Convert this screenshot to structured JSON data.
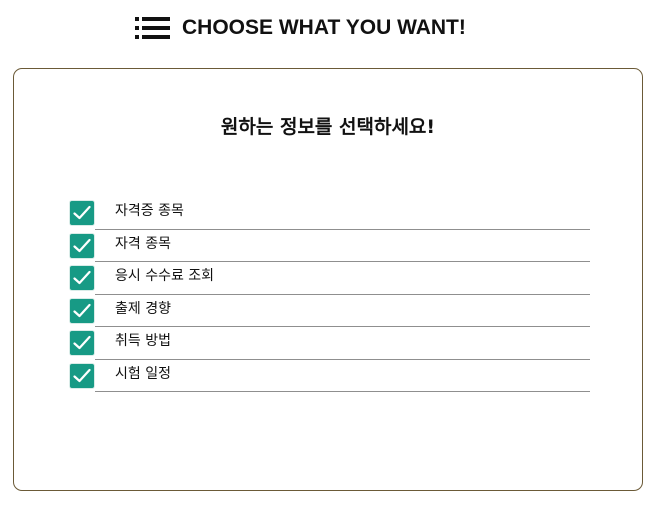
{
  "header": {
    "menu_icon": "hamburger-menu-icon",
    "title": "CHOOSE WHAT YOU WANT!"
  },
  "card": {
    "title": "원하는 정보를 선택하세요!",
    "accent_color": "#179a85",
    "options": [
      {
        "label": "자격증 종목",
        "checked": true
      },
      {
        "label": "자격 종목",
        "checked": true
      },
      {
        "label": "응시 수수료 조회",
        "checked": true
      },
      {
        "label": "출제 경향",
        "checked": true
      },
      {
        "label": "취득 방법",
        "checked": true
      },
      {
        "label": "시험 일정",
        "checked": true
      }
    ]
  }
}
